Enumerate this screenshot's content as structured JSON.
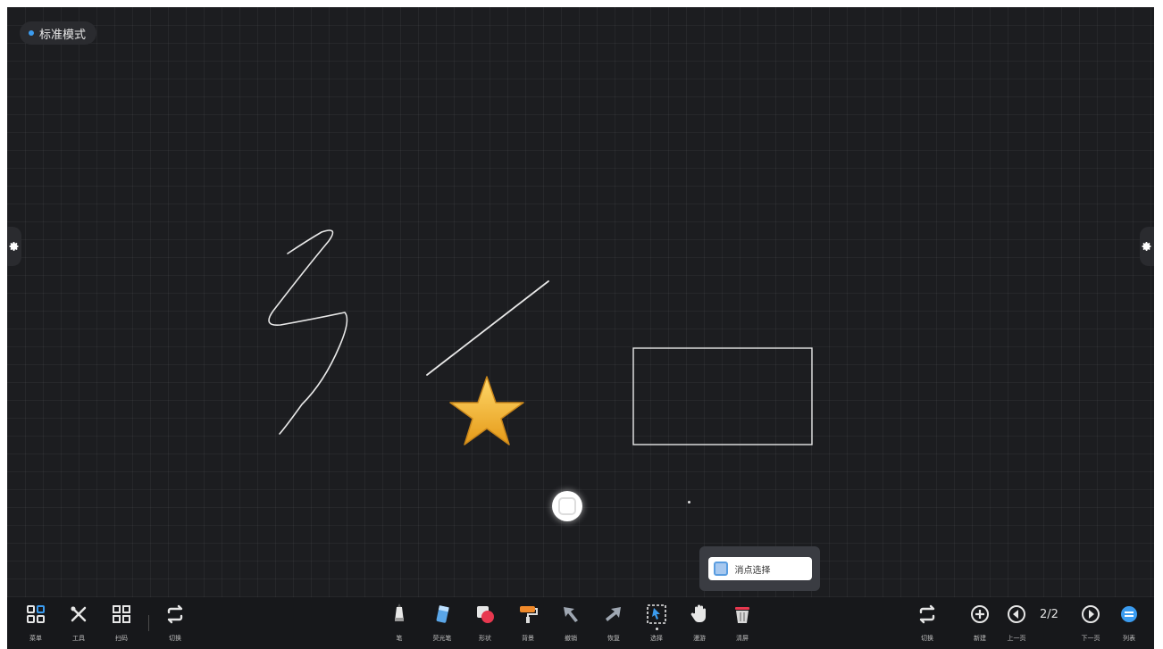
{
  "mode": {
    "label": "标准模式"
  },
  "popup": {
    "label": "消点选择"
  },
  "pager": {
    "current": "2/2"
  },
  "toolbar_left": [
    {
      "name": "menu",
      "icon": "grid-icon",
      "label": "菜单"
    },
    {
      "name": "tools",
      "icon": "tools-icon",
      "label": "工具"
    },
    {
      "name": "scan",
      "icon": "scan-icon",
      "label": "扫码"
    },
    {
      "name": "switch",
      "icon": "switch-icon",
      "label": "切换"
    }
  ],
  "toolbar_center": [
    {
      "name": "pen",
      "icon": "pen-icon",
      "label": "笔"
    },
    {
      "name": "highlighter",
      "icon": "highlighter-icon",
      "label": "荧光笔"
    },
    {
      "name": "shape",
      "icon": "shape-icon",
      "label": "形状"
    },
    {
      "name": "fill",
      "icon": "paint-roller-icon",
      "label": "背景"
    },
    {
      "name": "undo",
      "icon": "undo-arrow-icon",
      "label": "撤销"
    },
    {
      "name": "redo",
      "icon": "redo-arrow-icon",
      "label": "恢复"
    },
    {
      "name": "select",
      "icon": "select-icon",
      "label": "选择"
    },
    {
      "name": "roam",
      "icon": "hand-icon",
      "label": "漫游"
    },
    {
      "name": "clear",
      "icon": "trash-icon",
      "label": "清屏"
    }
  ],
  "toolbar_right": [
    {
      "name": "switch-right",
      "icon": "switch-icon",
      "label": "切换"
    },
    {
      "name": "new",
      "icon": "plus-circle-icon",
      "label": "新建"
    },
    {
      "name": "prev",
      "icon": "prev-circle-icon",
      "label": "上一页"
    },
    {
      "name": "next",
      "icon": "next-circle-icon",
      "label": "下一页"
    },
    {
      "name": "list",
      "icon": "list-circle-icon",
      "label": "列表"
    }
  ],
  "colors": {
    "board": "#1c1d20",
    "accent": "#3b9cf0",
    "star": "#f2b632"
  }
}
